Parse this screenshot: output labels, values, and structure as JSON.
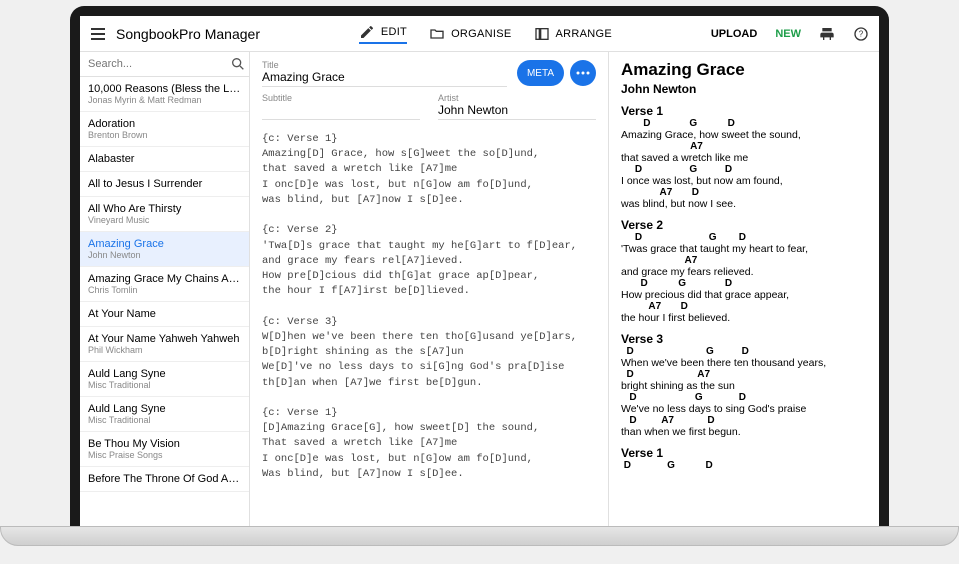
{
  "app": {
    "title": "SongbookPro Manager"
  },
  "nav": {
    "edit": "EDIT",
    "organise": "ORGANISE",
    "arrange": "ARRANGE",
    "upload": "UPLOAD",
    "new": "NEW"
  },
  "search": {
    "placeholder": "Search..."
  },
  "songs": [
    {
      "title": "10,000 Reasons (Bless the L…",
      "subtitle": "Jonas Myrin & Matt Redman"
    },
    {
      "title": "Adoration",
      "subtitle": "Brenton Brown"
    },
    {
      "title": "Alabaster",
      "subtitle": ""
    },
    {
      "title": "All to Jesus I Surrender",
      "subtitle": ""
    },
    {
      "title": "All Who Are Thirsty",
      "subtitle": "Vineyard Music"
    },
    {
      "title": "Amazing Grace",
      "subtitle": "John Newton",
      "selected": true
    },
    {
      "title": "Amazing Grace My Chains Ar…",
      "subtitle": "Chris Tomlin"
    },
    {
      "title": "At Your Name",
      "subtitle": ""
    },
    {
      "title": "At Your Name Yahweh Yahweh",
      "subtitle": "Phil Wickham"
    },
    {
      "title": "Auld Lang Syne",
      "subtitle": "Misc Traditional"
    },
    {
      "title": "Auld Lang Syne",
      "subtitle": "Misc Traditional"
    },
    {
      "title": "Be Thou My Vision",
      "subtitle": "Misc Praise Songs"
    },
    {
      "title": "Before The Throne Of God Ab…",
      "subtitle": ""
    }
  ],
  "editor": {
    "title_label": "Title",
    "title_value": "Amazing Grace",
    "subtitle_label": "Subtitle",
    "subtitle_value": "",
    "artist_label": "Artist",
    "artist_value": "John Newton",
    "meta_button": "META",
    "chordpro": "{c: Verse 1}\nAmazing[D] Grace, how s[G]weet the so[D]und,\nthat saved a wretch like [A7]me\nI onc[D]e was lost, but n[G]ow am fo[D]und,\nwas blind, but [A7]now I s[D]ee.\n\n{c: Verse 2}\n'Twa[D]s grace that taught my he[G]art to f[D]ear,\nand grace my fears rel[A7]ieved.\nHow pre[D]cious did th[G]at grace ap[D]pear,\nthe hour I f[A7]irst be[D]lieved.\n\n{c: Verse 3}\nW[D]hen we've been there ten tho[G]usand ye[D]ars,\nb[D]right shining as the s[A7]un\nWe[D]'ve no less days to si[G]ng God's pra[D]ise\nth[D]an when [A7]we first be[D]gun.\n\n{c: Verse 1}\n[D]Amazing Grace[G], how sweet[D] the sound,\nThat saved a wretch like [A7]me\nI onc[D]e was lost, but n[G]ow am fo[D]und,\nWas blind, but [A7]now I s[D]ee."
  },
  "preview": {
    "title": "Amazing Grace",
    "artist": "John Newton",
    "sections": [
      {
        "label": "Verse 1",
        "lines": [
          {
            "chords": "        D              G           D",
            "lyrics": "Amazing Grace, how sweet the sound,"
          },
          {
            "chords": "                         A7",
            "lyrics": "that saved a wretch like me"
          },
          {
            "chords": "     D                 G          D",
            "lyrics": "I once was lost, but now am found,"
          },
          {
            "chords": "              A7       D",
            "lyrics": "was blind, but now I see."
          }
        ]
      },
      {
        "label": "Verse 2",
        "lines": [
          {
            "chords": "     D                        G        D",
            "lyrics": "'Twas grace that taught my heart to fear,"
          },
          {
            "chords": "                       A7",
            "lyrics": "and grace my fears relieved."
          },
          {
            "chords": "       D           G              D",
            "lyrics": "How precious did that grace appear,"
          },
          {
            "chords": "          A7       D",
            "lyrics": "the hour I first believed."
          }
        ]
      },
      {
        "label": "Verse 3",
        "lines": [
          {
            "chords": "  D                          G          D",
            "lyrics": "When we've been there ten thousand years,"
          },
          {
            "chords": "  D                       A7",
            "lyrics": "bright shining as the sun"
          },
          {
            "chords": "   D                     G             D",
            "lyrics": "We've no less days to sing God's praise"
          },
          {
            "chords": "   D         A7            D",
            "lyrics": "than when we first begun."
          }
        ]
      },
      {
        "label": "Verse 1",
        "lines": [
          {
            "chords": " D             G           D",
            "lyrics": ""
          }
        ]
      }
    ]
  }
}
